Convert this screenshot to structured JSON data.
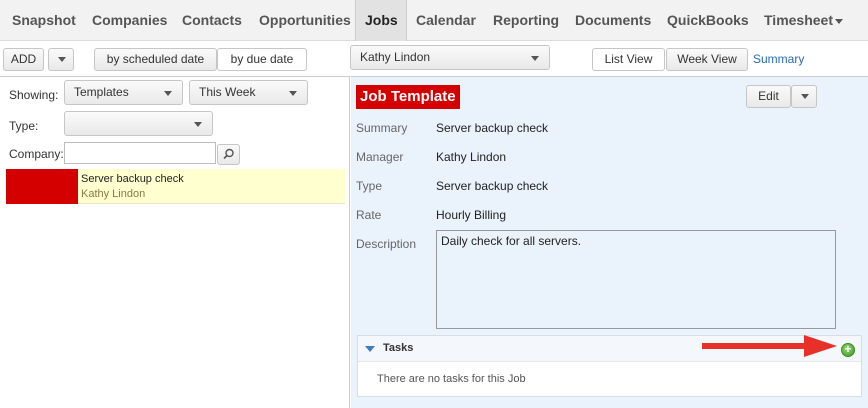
{
  "nav": {
    "items": [
      {
        "label": "Snapshot"
      },
      {
        "label": "Companies"
      },
      {
        "label": "Contacts"
      },
      {
        "label": "Opportunities"
      },
      {
        "label": "Jobs",
        "active": true
      },
      {
        "label": "Calendar"
      },
      {
        "label": "Reporting"
      },
      {
        "label": "Documents"
      },
      {
        "label": "QuickBooks"
      },
      {
        "label": "Timesheet"
      }
    ]
  },
  "toolbar": {
    "add_label": "ADD",
    "by_scheduled": "by scheduled date",
    "by_due": "by due date",
    "user_select": "Kathy Lindon",
    "list_view": "List View",
    "week_view": "Week View",
    "summary_link": "Summary"
  },
  "filters": {
    "showing_label": "Showing:",
    "showing_value": "Templates",
    "period_value": "This Week",
    "type_label": "Type:",
    "type_value": "",
    "company_label": "Company:",
    "company_value": ""
  },
  "job_list": [
    {
      "title": "Server backup check",
      "manager": "Kathy Lindon",
      "color": "#d40000"
    }
  ],
  "detail": {
    "header": "Job Template",
    "edit_label": "Edit",
    "fields": {
      "summary_label": "Summary",
      "summary_value": "Server backup check",
      "manager_label": "Manager",
      "manager_value": "Kathy Lindon",
      "type_label": "Type",
      "type_value": "Server backup check",
      "rate_label": "Rate",
      "rate_value": "Hourly Billing",
      "description_label": "Description",
      "description_value": "Daily check for all servers."
    },
    "tasks": {
      "title": "Tasks",
      "empty_text": "There are no tasks for this Job"
    }
  },
  "colors": {
    "accent_red": "#d40000",
    "link_blue": "#2a6bb5",
    "panel_blue": "#eaf2fb",
    "arrow_red": "#e8302a",
    "add_green": "#3f9a26"
  }
}
